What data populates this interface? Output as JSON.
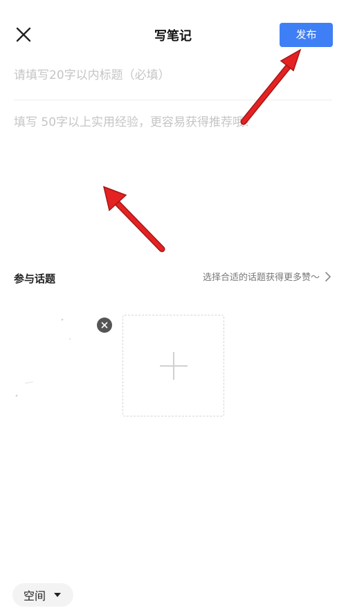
{
  "header": {
    "title": "写笔记",
    "publish_label": "发布"
  },
  "editor": {
    "title_placeholder": "请填写20字以内标题（必填）",
    "body_placeholder": "填写 50字以上实用经验，更容易获得推荐哦！"
  },
  "topic": {
    "label": "参与话题",
    "hint": "选择合适的话题获得更多赞～"
  },
  "bottom": {
    "scope_label": "空间"
  },
  "colors": {
    "accent": "#3f7ff5",
    "annotation": "#e52222"
  },
  "icons": [
    "close-icon",
    "chevron-right-icon",
    "remove-icon",
    "plus-icon",
    "caret-down-icon"
  ]
}
